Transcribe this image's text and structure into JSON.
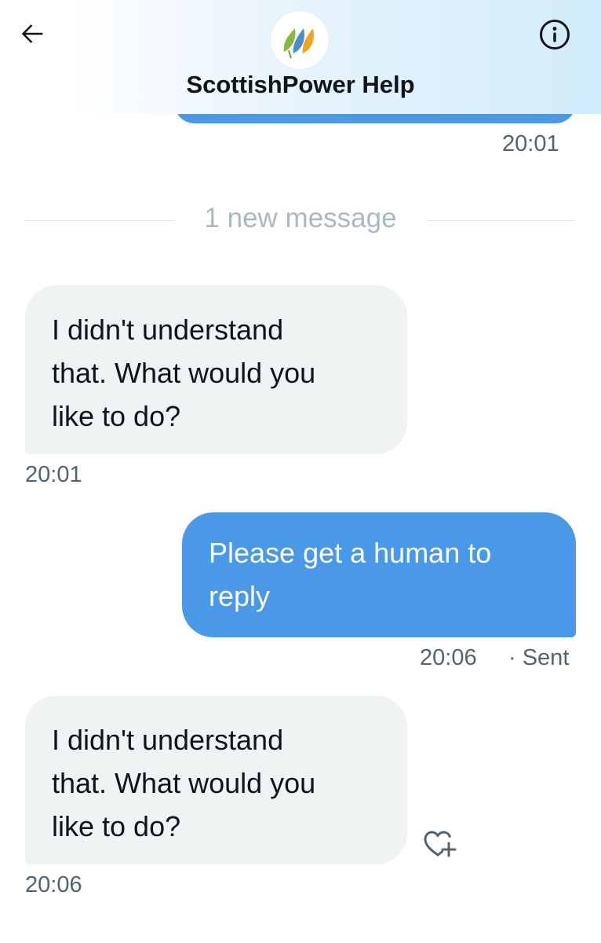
{
  "header": {
    "title": "ScottishPower Help",
    "back_icon": "arrow-left-icon",
    "info_icon": "info-icon",
    "avatar_icon": "scottishpower-logo",
    "logo_colors": [
      "#8cb83a",
      "#4a8ec8",
      "#f2a31c"
    ]
  },
  "conversation": {
    "previous_time": "20:01",
    "divider_label": "1 new message",
    "messages": [
      {
        "direction": "received",
        "text": "I didn't understand\nthat. What would you\nlike to do?",
        "time": "20:01"
      },
      {
        "direction": "sent",
        "text": "Please get a human to\nreply",
        "time": "20:06",
        "status": "· Sent"
      },
      {
        "direction": "received",
        "text": "I didn't understand\nthat. What would you\nlike to do?",
        "time": "20:06",
        "reaction_icon": "heart-plus-icon"
      }
    ]
  },
  "colors": {
    "sent_bubble": "#4a99e9",
    "received_bubble": "#eff3f4",
    "timestamp": "#536471",
    "divider_text": "#aab8c2"
  }
}
